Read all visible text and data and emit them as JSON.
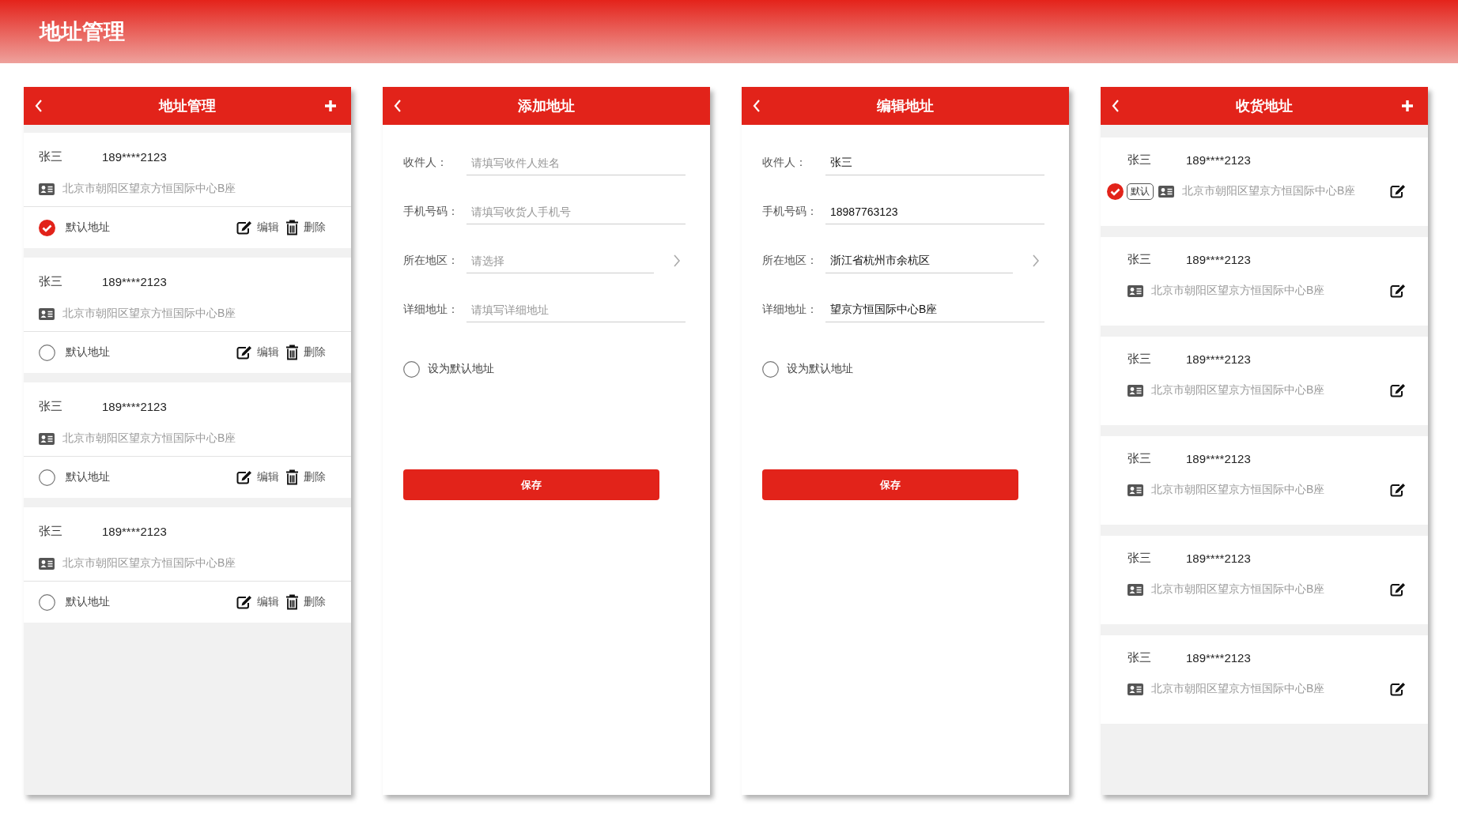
{
  "page_title": "地址管理",
  "screens": [
    {
      "kind": "list",
      "title": "地址管理",
      "show_add": true,
      "addresses": [
        {
          "name": "张三",
          "phone": "189****2123",
          "address": "北京市朝阳区望京方恒国际中心B座",
          "default_label": "默认地址",
          "selected": true,
          "edit": "编辑",
          "delete": "删除"
        },
        {
          "name": "张三",
          "phone": "189****2123",
          "address": "北京市朝阳区望京方恒国际中心B座",
          "default_label": "默认地址",
          "selected": false,
          "edit": "编辑",
          "delete": "删除"
        },
        {
          "name": "张三",
          "phone": "189****2123",
          "address": "北京市朝阳区望京方恒国际中心B座",
          "default_label": "默认地址",
          "selected": false,
          "edit": "编辑",
          "delete": "删除"
        },
        {
          "name": "张三",
          "phone": "189****2123",
          "address": "北京市朝阳区望京方恒国际中心B座",
          "default_label": "默认地址",
          "selected": false,
          "edit": "编辑",
          "delete": "删除"
        }
      ]
    },
    {
      "kind": "form",
      "title": "添加地址",
      "show_add": false,
      "fields": [
        {
          "kind": "text",
          "label": "收件人：",
          "placeholder": "请填写收件人姓名"
        },
        {
          "kind": "text",
          "label": "手机号码：",
          "placeholder": "请填写收货人手机号"
        },
        {
          "kind": "picker",
          "label": "所在地区：",
          "placeholder": "请选择"
        },
        {
          "kind": "text",
          "label": "详细地址：",
          "placeholder": "请填写详细地址"
        }
      ],
      "default_option": {
        "label": "设为默认地址",
        "checked": false
      },
      "save": "保存"
    },
    {
      "kind": "form",
      "title": "编辑地址",
      "show_add": false,
      "fields": [
        {
          "kind": "text",
          "label": "收件人：",
          "value": "张三"
        },
        {
          "kind": "text",
          "label": "手机号码：",
          "value": "18987763123"
        },
        {
          "kind": "picker",
          "label": "所在地区：",
          "value": "浙江省杭州市余杭区"
        },
        {
          "kind": "text",
          "label": "详细地址：",
          "value": "望京方恒国际中心B座"
        }
      ],
      "default_option": {
        "label": "设为默认地址",
        "checked": false
      },
      "save": "保存"
    },
    {
      "kind": "compact_list",
      "title": "收货地址",
      "show_add": true,
      "addresses": [
        {
          "name": "张三",
          "phone": "189****2123",
          "address": "北京市朝阳区望京方恒国际中心B座",
          "is_default": true,
          "badge": "默认"
        },
        {
          "name": "张三",
          "phone": "189****2123",
          "address": "北京市朝阳区望京方恒国际中心B座",
          "is_default": false
        },
        {
          "name": "张三",
          "phone": "189****2123",
          "address": "北京市朝阳区望京方恒国际中心B座",
          "is_default": false
        },
        {
          "name": "张三",
          "phone": "189****2123",
          "address": "北京市朝阳区望京方恒国际中心B座",
          "is_default": false
        },
        {
          "name": "张三",
          "phone": "189****2123",
          "address": "北京市朝阳区望京方恒国际中心B座",
          "is_default": false
        },
        {
          "name": "张三",
          "phone": "189****2123",
          "address": "北京市朝阳区望京方恒国际中心B座",
          "is_default": false
        }
      ]
    }
  ]
}
